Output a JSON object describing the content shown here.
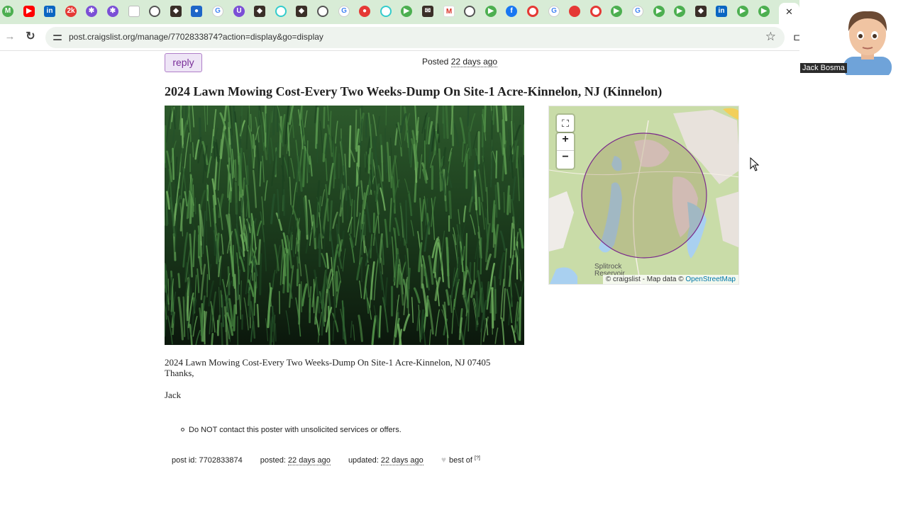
{
  "browser": {
    "url": "post.craigslist.org/manage/7702833874?action=display&go=display",
    "tab_close_glyph": "✕",
    "tabs": [
      {
        "icon": "medium-icon",
        "glyph": "M",
        "cls": "ti-green"
      },
      {
        "icon": "youtube-icon",
        "glyph": "▶",
        "cls": "ti-yt"
      },
      {
        "icon": "linkedin-icon",
        "glyph": "in",
        "cls": "ti-li"
      },
      {
        "icon": "news-icon",
        "glyph": "2k",
        "cls": "ti-red"
      },
      {
        "icon": "purple-gear-icon",
        "glyph": "✱",
        "cls": "ti-purple"
      },
      {
        "icon": "purple-gear-icon",
        "glyph": "✱",
        "cls": "ti-purple"
      },
      {
        "icon": "blank-page-icon",
        "glyph": "",
        "cls": "ti-white"
      },
      {
        "icon": "openai-icon",
        "glyph": "",
        "cls": "ti-ring"
      },
      {
        "icon": "dark-app-icon",
        "glyph": "◆",
        "cls": "ti-dark"
      },
      {
        "icon": "blue-circle-icon",
        "glyph": "●",
        "cls": "ti-blue"
      },
      {
        "icon": "google-icon",
        "glyph": "G",
        "cls": "ti-g"
      },
      {
        "icon": "tor-icon",
        "glyph": "U",
        "cls": "ti-purple"
      },
      {
        "icon": "dark-app-icon",
        "glyph": "◆",
        "cls": "ti-dark"
      },
      {
        "icon": "teal-icon",
        "glyph": "",
        "cls": "ti-teal"
      },
      {
        "icon": "dark-app-icon",
        "glyph": "◆",
        "cls": "ti-dark"
      },
      {
        "icon": "openai-icon",
        "glyph": "",
        "cls": "ti-ring"
      },
      {
        "icon": "google-icon",
        "glyph": "G",
        "cls": "ti-g"
      },
      {
        "icon": "reddit-icon",
        "glyph": "●",
        "cls": "ti-red"
      },
      {
        "icon": "teal-icon",
        "glyph": "",
        "cls": "ti-teal"
      },
      {
        "icon": "play-icon",
        "glyph": "▶",
        "cls": "ti-green"
      },
      {
        "icon": "mail-icon",
        "glyph": "✉",
        "cls": "ti-dark"
      },
      {
        "icon": "gmail-icon",
        "glyph": "M",
        "cls": "ti-gmail"
      },
      {
        "icon": "globe-icon",
        "glyph": "◍",
        "cls": "ti-ring"
      },
      {
        "icon": "play-icon",
        "glyph": "▶",
        "cls": "ti-green"
      },
      {
        "icon": "facebook-icon",
        "glyph": "f",
        "cls": "ti-fb"
      },
      {
        "icon": "record-icon",
        "glyph": "",
        "cls": "ti-target"
      },
      {
        "icon": "google-icon",
        "glyph": "G",
        "cls": "ti-g"
      },
      {
        "icon": "red-dot-icon",
        "glyph": "",
        "cls": "ti-red"
      },
      {
        "icon": "record-icon",
        "glyph": "",
        "cls": "ti-target"
      },
      {
        "icon": "play-icon",
        "glyph": "▶",
        "cls": "ti-green"
      },
      {
        "icon": "google-icon",
        "glyph": "G",
        "cls": "ti-g"
      },
      {
        "icon": "play-icon",
        "glyph": "▶",
        "cls": "ti-green"
      },
      {
        "icon": "play-icon",
        "glyph": "▶",
        "cls": "ti-green"
      },
      {
        "icon": "dark-app-icon",
        "glyph": "◆",
        "cls": "ti-dark"
      },
      {
        "icon": "linkedin-icon",
        "glyph": "in",
        "cls": "ti-li"
      },
      {
        "icon": "play-icon",
        "glyph": "▶",
        "cls": "ti-green"
      },
      {
        "icon": "play-icon",
        "glyph": "▶",
        "cls": "ti-green"
      }
    ]
  },
  "webcam": {
    "name": "Jack Bosma"
  },
  "post": {
    "reply_label": "reply",
    "posted_prefix": "Posted",
    "posted_ago": "22 days ago",
    "title": "2024 Lawn Mowing Cost-Every Two Weeks-Dump On Site-1 Acre-Kinnelon, NJ (Kinnelon)",
    "body_line1": "2024 Lawn Mowing Cost-Every Two Weeks-Dump On Site-1 Acre-Kinnelon, NJ 07405",
    "body_line2": "Thanks,",
    "signature": "Jack",
    "notice": "Do NOT contact this poster with unsolicited services or offers."
  },
  "map": {
    "attribution_prefix": "© craigslist - Map data ©",
    "attribution_link": "OpenStreetMap",
    "place_label": "Splitrock Reservoir"
  },
  "postinfo": {
    "post_id_label": "post id:",
    "post_id": "7702833874",
    "posted_label": "posted:",
    "posted_value": "22 days ago",
    "updated_label": "updated:",
    "updated_value": "22 days ago",
    "best_of": "best of",
    "best_of_sup": "[?]"
  },
  "colors": {
    "tabstrip_bg": "#d8ecd6",
    "reply_bg": "#eee5f6",
    "reply_text": "#7a2f9a",
    "map_land": "#c9dca8",
    "map_water": "#a9d0f0",
    "map_circle": "#7b2a8c",
    "map_link": "#0078a8"
  }
}
